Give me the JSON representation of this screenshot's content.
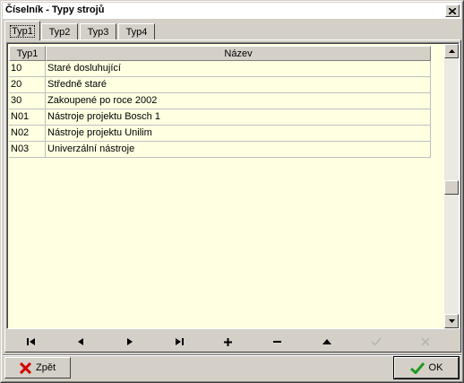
{
  "window": {
    "title": "Číselník - Typy strojů"
  },
  "tabs": [
    {
      "label": "Typ1",
      "active": true
    },
    {
      "label": "Typ2",
      "active": false
    },
    {
      "label": "Typ3",
      "active": false
    },
    {
      "label": "Typ4",
      "active": false
    }
  ],
  "grid": {
    "columns": [
      "Typ1",
      "Název"
    ],
    "rows": [
      [
        "10",
        "Staré dosluhující"
      ],
      [
        "20",
        "Středně staré"
      ],
      [
        "30",
        "Zakoupené po roce 2002"
      ],
      [
        "N01",
        "Nástroje projektu Bosch 1"
      ],
      [
        "N02",
        "Nástroje projektu Unilim"
      ],
      [
        "N03",
        "Univerzální nástroje"
      ]
    ],
    "background": "#ffffe1"
  },
  "navigator": [
    {
      "name": "first-record",
      "icon": "first-icon",
      "enabled": true
    },
    {
      "name": "prior-record",
      "icon": "prior-icon",
      "enabled": true
    },
    {
      "name": "next-record",
      "icon": "next-icon",
      "enabled": true
    },
    {
      "name": "last-record",
      "icon": "last-icon",
      "enabled": true
    },
    {
      "name": "insert-record",
      "icon": "plus-icon",
      "enabled": true
    },
    {
      "name": "delete-record",
      "icon": "minus-icon",
      "enabled": true
    },
    {
      "name": "edit-record",
      "icon": "up-triangle-icon",
      "enabled": true
    },
    {
      "name": "post-record",
      "icon": "check-icon",
      "enabled": false
    },
    {
      "name": "cancel-record",
      "icon": "cancel-x-icon",
      "enabled": false
    }
  ],
  "buttons": {
    "back_label": "Zpět",
    "ok_label": "OK"
  },
  "colors": {
    "back_icon": "#d40000",
    "ok_icon": "#1f9a1f"
  }
}
